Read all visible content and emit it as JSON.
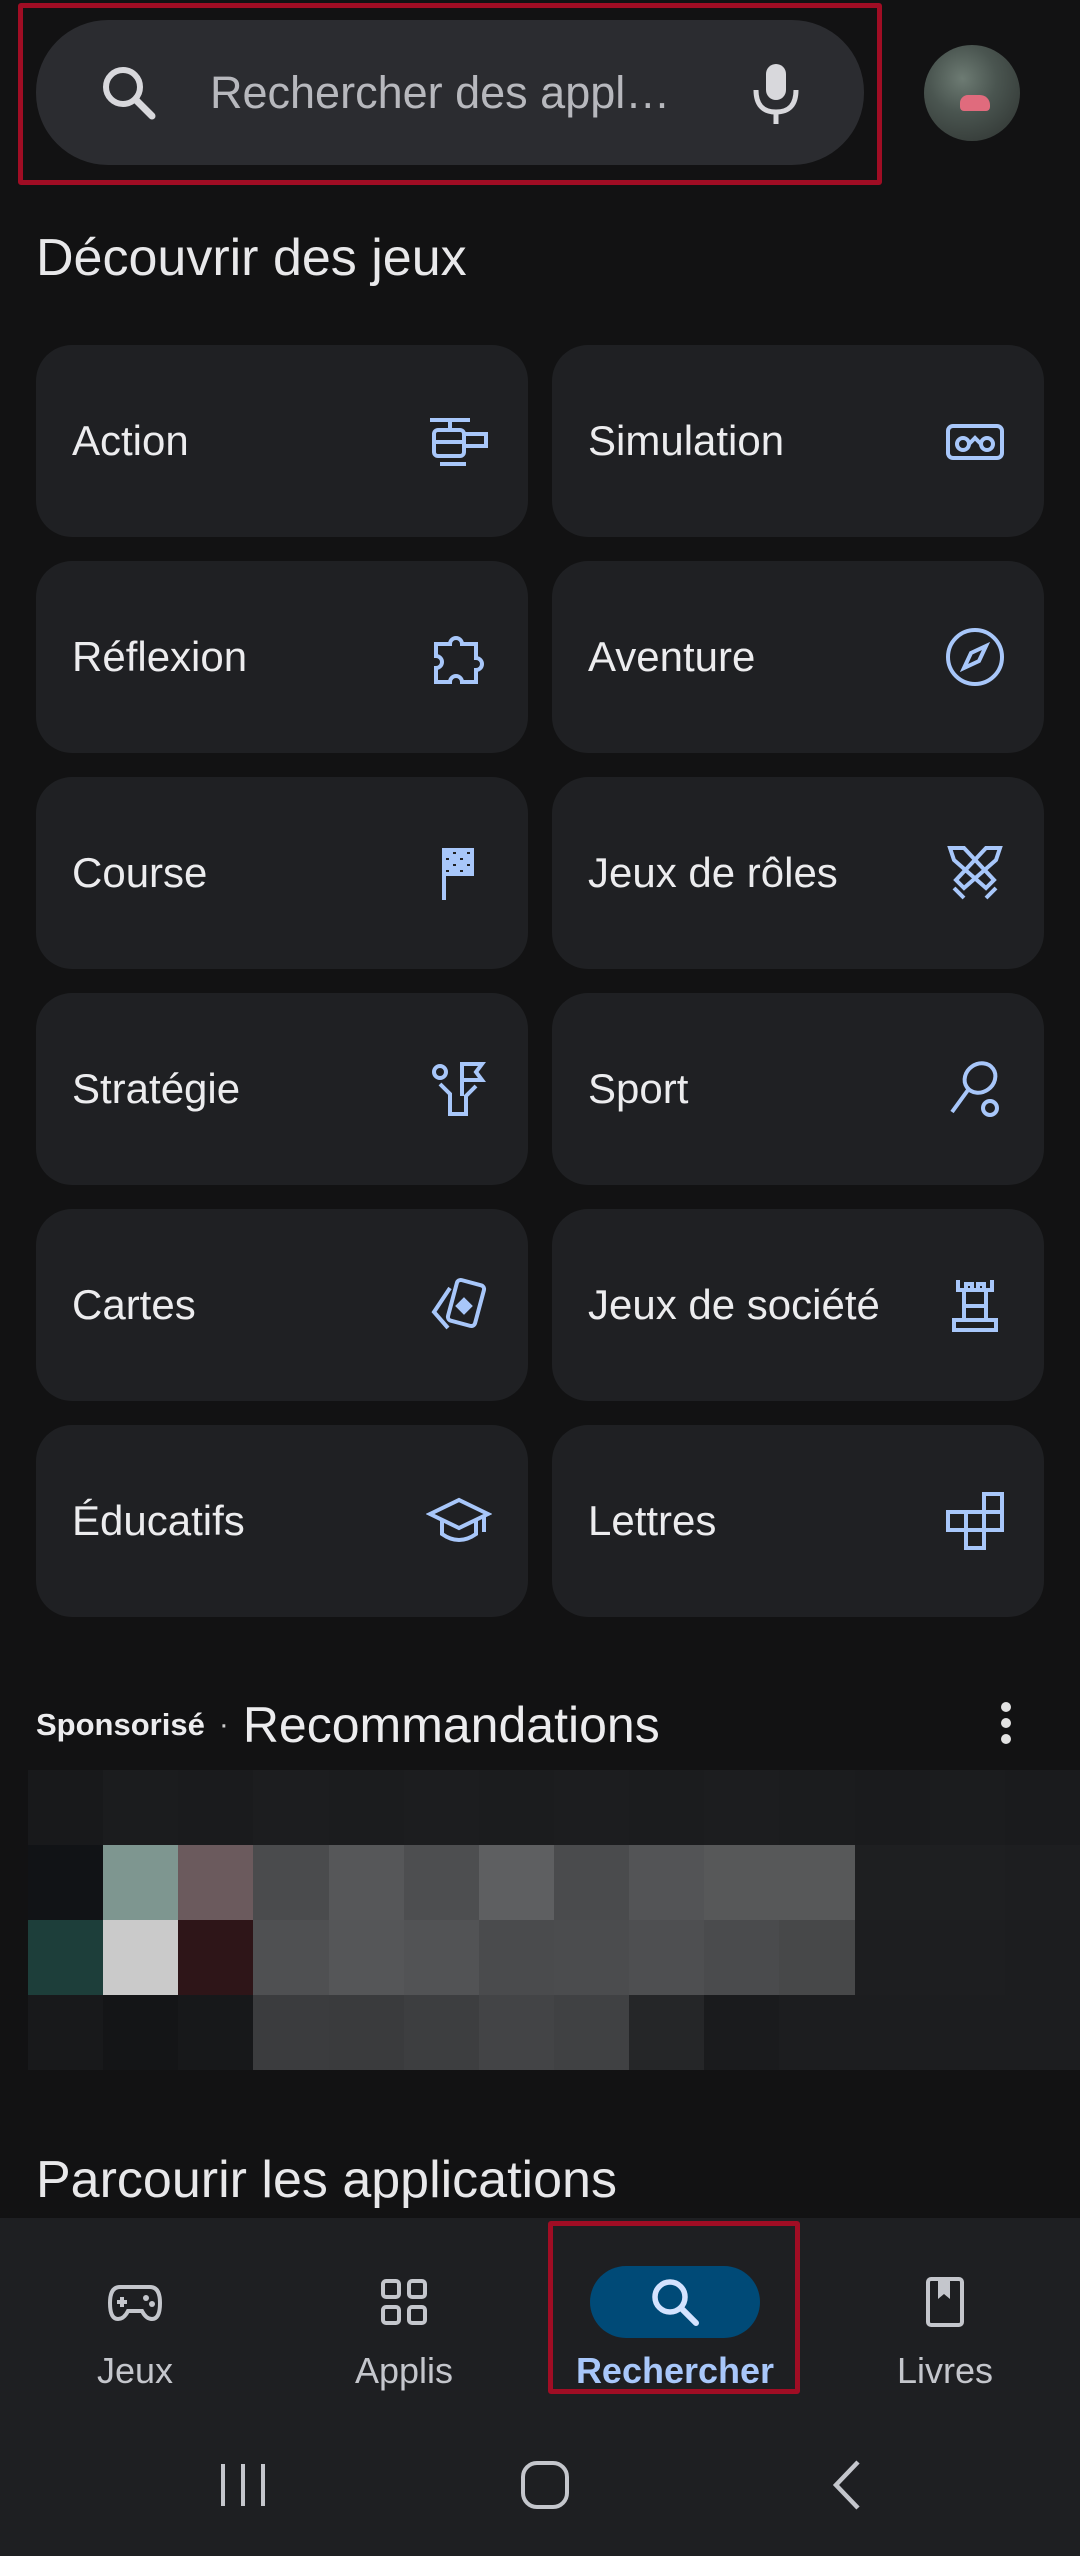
{
  "search": {
    "placeholder": "Rechercher des appl…"
  },
  "discover": {
    "title": "Découvrir des jeux",
    "categories": [
      {
        "label": "Action",
        "icon": "helicopter-icon"
      },
      {
        "label": "Simulation",
        "icon": "vr-headset-icon"
      },
      {
        "label": "Réflexion",
        "icon": "puzzle-icon"
      },
      {
        "label": "Aventure",
        "icon": "compass-icon"
      },
      {
        "label": "Course",
        "icon": "checkered-flag-icon"
      },
      {
        "label": "Jeux de rôles",
        "icon": "crossed-swords-icon"
      },
      {
        "label": "Stratégie",
        "icon": "strategy-flag-icon"
      },
      {
        "label": "Sport",
        "icon": "tennis-racket-icon"
      },
      {
        "label": "Cartes",
        "icon": "playing-cards-icon"
      },
      {
        "label": "Jeux de société",
        "icon": "chess-rook-icon"
      },
      {
        "label": "Éducatifs",
        "icon": "graduation-cap-icon"
      },
      {
        "label": "Lettres",
        "icon": "word-tiles-icon"
      }
    ]
  },
  "recommendations": {
    "sponsored": "Sponsorisé",
    "separator": "·",
    "title": "Recommandations"
  },
  "browse": {
    "title": "Parcourir les applications"
  },
  "bottom_nav": {
    "items": [
      {
        "label": "Jeux",
        "icon": "gamepad-icon",
        "active": false
      },
      {
        "label": "Applis",
        "icon": "apps-grid-icon",
        "active": false
      },
      {
        "label": "Rechercher",
        "icon": "search-icon",
        "active": true
      },
      {
        "label": "Livres",
        "icon": "bookmark-book-icon",
        "active": false
      }
    ]
  },
  "colors": {
    "accent": "#a8c7fa",
    "active_pill": "#004a77",
    "highlight": "#a00d24"
  }
}
